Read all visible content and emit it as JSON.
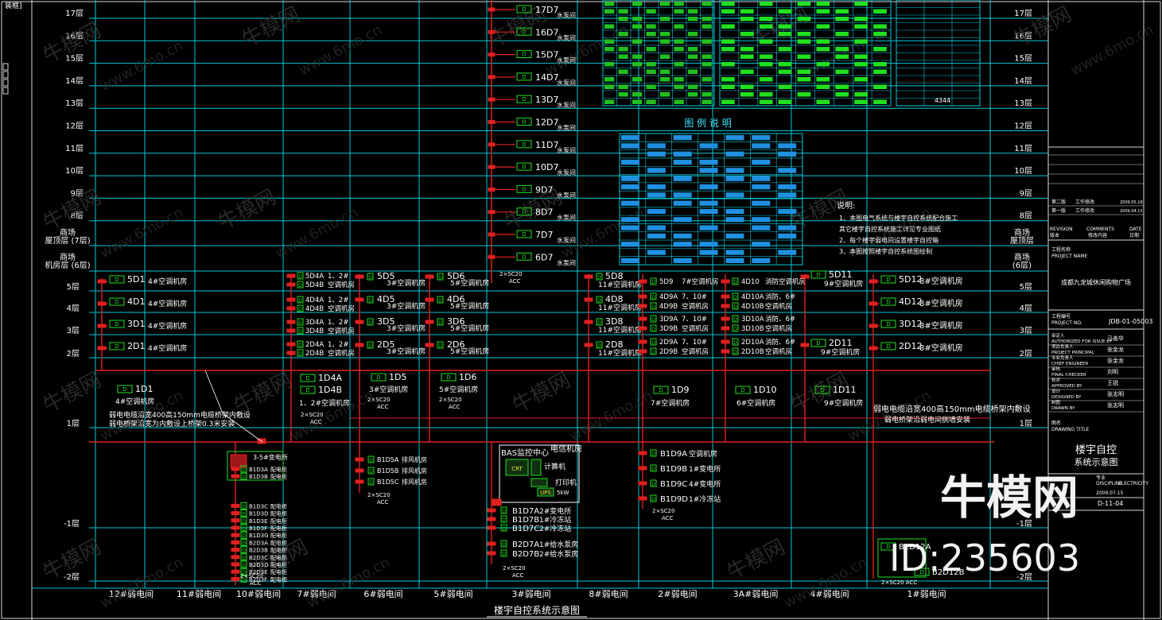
{
  "colors": {
    "background": "#000000",
    "grid": "#00c8d8",
    "cable": "#e02020",
    "device": "#20e020",
    "text": "#ffffff",
    "frame": "#d8d8d8",
    "yellow_text": "#f0e040",
    "cyan_text": "#40e0ff"
  },
  "corner_tag": "装框]",
  "floors": [
    {
      "label": "17层",
      "row": 0
    },
    {
      "label": "16层",
      "row": 1
    },
    {
      "label": "15层",
      "row": 2
    },
    {
      "label": "14层",
      "row": 3
    },
    {
      "label": "13层",
      "row": 4
    },
    {
      "label": "12层",
      "row": 5
    },
    {
      "label": "11层",
      "row": 6
    },
    {
      "label": "10层",
      "row": 7
    },
    {
      "label": "9层",
      "row": 8
    },
    {
      "label": "8层",
      "row": 9
    }
  ],
  "mall_levels": [
    {
      "line1": "商场",
      "line2": "屋顶层 (7层)"
    },
    {
      "line1": "商场",
      "line2": "机房层 (6层)"
    }
  ],
  "right_mall_levels": [
    {
      "line1": "商场",
      "line2": "屋顶层"
    },
    {
      "line1": "商场",
      "line2": "(6层)"
    }
  ],
  "lower_floors": [
    "5层",
    "4层",
    "3层",
    "2层",
    "1层",
    "-1层",
    "-2层"
  ],
  "shaft_labels": [
    "12#弱电间",
    "11#弱电间",
    "10#弱电间",
    "7#弱电间",
    "6#弱电间",
    "5#弱电间",
    "3#弱电间",
    "8#弱电间",
    "2#弱电间",
    "3A#弱电间",
    "4#弱电间",
    "1#弱电间"
  ],
  "tower_ddc": [
    "17D7",
    "16D7",
    "15D7",
    "14D7",
    "13D7",
    "12D7",
    "11D7",
    "10D7",
    "9D7",
    "8D7",
    "7D7",
    "6D7"
  ],
  "tower_room": "水泵间",
  "tower_cable": {
    "line1": "2×SC20",
    "line2": "ACC"
  },
  "legend_title": "图 例 说 明",
  "notes_title": "说明:",
  "notes": [
    "1、本图电气系统与楼宇自控系统配合施工",
    "   其它楼宇自控系统施工详见专业图纸",
    "2、每个楼宇弱电间设置楼宇自控箱",
    "3、本图按照楼宇自控系统图绘制"
  ],
  "cable_note_left": [
    "弱电电缆沿宽400高150mm电缆桥架内敷设",
    "弱电桥架沿宽为内敷设上桥架0.3米安装"
  ],
  "cable_note_right": [
    "弱电电缆沿宽400高150mm电缆桥架内敷设",
    "弱电桥架沿弱电间侧墙安装"
  ],
  "col12": {
    "devices": [
      [
        "5D1",
        "4#空调机房"
      ],
      [
        "4D1",
        "4#空调机房"
      ],
      [
        "3D1",
        "4#空调机房"
      ],
      [
        "2D1",
        "4#空调机房"
      ]
    ],
    "bottom": [
      "1D1",
      "4#空调机房"
    ]
  },
  "col7": {
    "devices": [
      [
        "5D4A",
        "1、2#"
      ],
      [
        "5D4B",
        "空调机房"
      ],
      [
        "4D4A",
        "1、2#"
      ],
      [
        "4D4B",
        "空调机房"
      ],
      [
        "3D4A",
        "1、2#"
      ],
      [
        "3D4B",
        "空调机房"
      ],
      [
        "2D4A",
        "1、2#"
      ],
      [
        "2D4B",
        "空调机房"
      ]
    ],
    "bottom": [
      "1D4A",
      "1D4B",
      "1、2#空调机房"
    ],
    "cable": [
      "2×SC20",
      "ACC"
    ]
  },
  "col6": {
    "devices": [
      [
        "5D5",
        "3#空调机房"
      ],
      [
        "4D5",
        "3#空调机房"
      ],
      [
        "3D5",
        "3#空调机房"
      ],
      [
        "2D5",
        "3#空调机房"
      ]
    ],
    "bottom": [
      "1D5",
      "3#空调机房"
    ],
    "cable": [
      "2×SC20",
      "ACC"
    ],
    "basement": [
      "B1D5A",
      "B1D5B",
      "B1D5C"
    ],
    "basement_room": "排风机房",
    "bcable": [
      "2×SC20",
      "ACC"
    ]
  },
  "col5": {
    "devices": [
      [
        "5D6",
        "5#空调机房"
      ],
      [
        "4D6",
        "5#空调机房"
      ],
      [
        "3D6",
        "5#空调机房"
      ],
      [
        "2D6",
        "5#空调机房"
      ]
    ],
    "bottom": [
      "1D6",
      "5#空调机房"
    ],
    "cable": [
      "2×SC20",
      "ACC"
    ]
  },
  "col8": {
    "devices": [
      [
        "5D8",
        "11#空调机房"
      ],
      [
        "4D8",
        "11#空调机房"
      ],
      [
        "3D8",
        "11#空调机房"
      ],
      [
        "2D8",
        "11#空调机房"
      ]
    ]
  },
  "col2": {
    "devices": [
      [
        "5D9",
        "7#空调机房"
      ],
      [
        "4D9A",
        "7、10#"
      ],
      [
        "4D9B",
        "空调机房"
      ],
      [
        "3D9A",
        "7、10#"
      ],
      [
        "3D9B",
        "空调机房"
      ],
      [
        "2D9A",
        "7、10#"
      ],
      [
        "2D9B",
        "空调机房"
      ]
    ],
    "bottom": [
      "1D9",
      "7#空调机房"
    ],
    "basement": [
      [
        "B1D9A",
        "空调机房"
      ],
      [
        "B1D9B",
        "1#变电所"
      ],
      [
        "B1D9C",
        "4#变电所"
      ],
      [
        "B1D9D",
        "1#冷冻站"
      ]
    ],
    "bcable": [
      "2×SC20",
      "ACC"
    ]
  },
  "col3a": {
    "devices": [
      [
        "4D10",
        "消防空调机房"
      ],
      [
        "4D10A",
        "消防、6#"
      ],
      [
        "4D10B",
        "空调机房"
      ],
      [
        "3D10A",
        "消防、6#"
      ],
      [
        "3D10B",
        "空调机房"
      ],
      [
        "2D10A",
        "消防、6#"
      ],
      [
        "2D10B",
        "空调机房"
      ]
    ],
    "bottom": [
      "1D10",
      "6#空调机房"
    ]
  },
  "col4": {
    "devices": [
      [
        "5D11",
        "9#空调机房"
      ],
      [
        "2D11",
        "9#空调机房"
      ]
    ],
    "bottom": [
      "1D11",
      "9#空调机房"
    ]
  },
  "col1": {
    "devices": [
      [
        "5D12",
        "8#空调机房"
      ],
      [
        "4D12",
        "8#空调机房"
      ],
      [
        "3D12",
        "8#空调机房"
      ],
      [
        "2D12",
        "8#空调机房"
      ]
    ],
    "basement": [
      "B2D12A",
      "B2D12B"
    ],
    "bcable": [
      "2×SC20",
      "ACC"
    ]
  },
  "col10": {
    "head": "3-5#变电所",
    "devices": [
      "B1D3A",
      "B1D3B",
      "B1D3C",
      "B1D3D",
      "B1D3E",
      "B1D3F",
      "B1D3G",
      "B2D3A",
      "B2D3B",
      "B2D3C",
      "B2D3D",
      "B2D3E",
      "B2D3F"
    ],
    "cable": [
      "2×SC20",
      "ACC"
    ]
  },
  "bas_center": {
    "title": "BAS监控中心",
    "title2": "电信机房",
    "computer": "计算机",
    "printer": "打印机",
    "ups": "UPS",
    "ups2": "5kW",
    "sub_labels": [
      "CRT",
      "CRT"
    ]
  },
  "col3": {
    "devices": [
      [
        "B1D7A",
        "2#变电所"
      ],
      [
        "B1D7B",
        "1#冷冻站"
      ],
      [
        "B1D7C",
        "2#冷冻站"
      ],
      [
        "B2D7A",
        "1#给水泵房"
      ],
      [
        "B2D7B",
        "2#给水泵房"
      ]
    ],
    "cable": [
      "2×SC20",
      "ACC"
    ]
  },
  "caption": "楼宇自控系统示意图",
  "title_block": {
    "project_name_label": "工程名称",
    "project_name_en": "PROJECT NAME",
    "project_name": "成都九龙城休闲购物广场",
    "project_no_label": "工程编号",
    "project_no_en": "PROJECT NO.",
    "project_no": "JDB-01-05003",
    "revision_label": "REVISION",
    "revision_sub": "版本",
    "comments_label": "COMMENTS",
    "comments_sub": "修改内容",
    "date_label": "DATE",
    "date_sub": "日期",
    "rev_rows": [
      [
        "第二版",
        "工作修改",
        "2009.05.18"
      ],
      [
        "第一版",
        "工作修改",
        "2009.04.15"
      ]
    ],
    "signers": [
      [
        "审定人",
        "AUTHORIZED FOR ISSUE BY",
        "马善华"
      ],
      [
        "项目负责人",
        "PROJECT PRINCIPAL",
        "张金龙"
      ],
      [
        "专业负责人",
        "CHIEF ENGINEER",
        "张金龙"
      ],
      [
        "审核",
        "FINAL CHECKER",
        "刘明"
      ],
      [
        "校对",
        "APPROVED BY",
        "王锐"
      ],
      [
        "设计",
        "DESIGNED BY",
        "张志明"
      ],
      [
        "制图",
        "DRAWN BY",
        "张志明"
      ]
    ],
    "drawing_title_label": "图名",
    "drawing_title_en": "DRAWING TITLE",
    "drawing_title_1": "楼宇自控",
    "drawing_title_2": "系统示意图",
    "discipline_label": "专业",
    "discipline_en": "DISCIPLINE",
    "discipline": "ELECTRICITY",
    "date_val": "2009.07.15",
    "drawing_no": "D-11-04"
  },
  "watermark_text": "牛模网",
  "watermark_url": "www.6mo.cn",
  "id_text": "ID:235603"
}
